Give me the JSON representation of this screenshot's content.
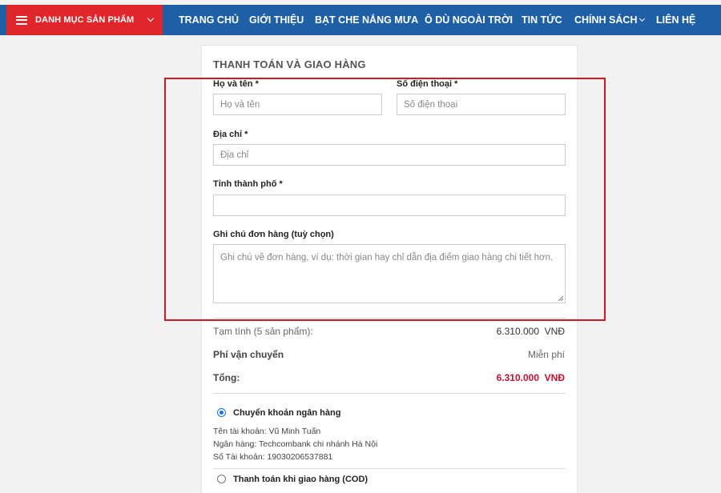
{
  "nav": {
    "category_label": "DANH MỤC SẢN PHẨM",
    "items": [
      {
        "label": "TRANG CHỦ"
      },
      {
        "label": "GIỚI THIỆU"
      },
      {
        "label": "BẠT CHE NẮNG MƯA"
      },
      {
        "label": "Ô DÙ NGOÀI TRỜI"
      },
      {
        "label": "TIN TỨC"
      },
      {
        "label": "CHÍNH SÁCH"
      },
      {
        "label": "LIÊN HỆ"
      }
    ]
  },
  "checkout": {
    "title": "THANH TOÁN VÀ GIAO HÀNG",
    "fields": {
      "name": {
        "label": "Họ và tên *",
        "placeholder": "Họ và tên",
        "value": ""
      },
      "phone": {
        "label": "Số điện thoại *",
        "placeholder": "Số điện thoại",
        "value": ""
      },
      "address": {
        "label": "Địa chỉ *",
        "placeholder": "Địa chỉ",
        "value": ""
      },
      "city": {
        "label": "Tỉnh thành phố *",
        "placeholder": "",
        "value": ""
      },
      "note": {
        "label": "Ghi chú đơn hàng (tuỳ chọn)",
        "placeholder": "Ghi chú về đơn hàng, ví dụ: thời gian hay chỉ dẫn địa điểm giao hàng chi tiết hơn.",
        "value": ""
      }
    }
  },
  "summary": {
    "subtotal_label": "Tạm tính (5 sản phẩm):",
    "subtotal_value": "6.310.000  VNĐ",
    "shipping_label": "Phí vận chuyển",
    "shipping_value": "Miễn phí",
    "total_label": "Tổng:",
    "total_value": "6.310.000  VNĐ"
  },
  "payment": {
    "bank": {
      "label": "Chuyển khoản ngân hàng",
      "selected": true,
      "account_name": "Tên tài khoản: Vũ Minh Tuấn",
      "bank_name": "Ngân hàng: Techcombank chi nhánh Hà Nội",
      "account_number": "Số Tài khoản: 19030206537881"
    },
    "cod": {
      "label": "Thanh toán khi giao hàng (COD)",
      "selected": false
    }
  },
  "colors": {
    "nav_bg": "#1f5fa6",
    "category_bg": "#e1262b",
    "total_red": "#c8102e",
    "highlight_border": "#d6191f",
    "radio_selected": "#1d6fd8"
  }
}
